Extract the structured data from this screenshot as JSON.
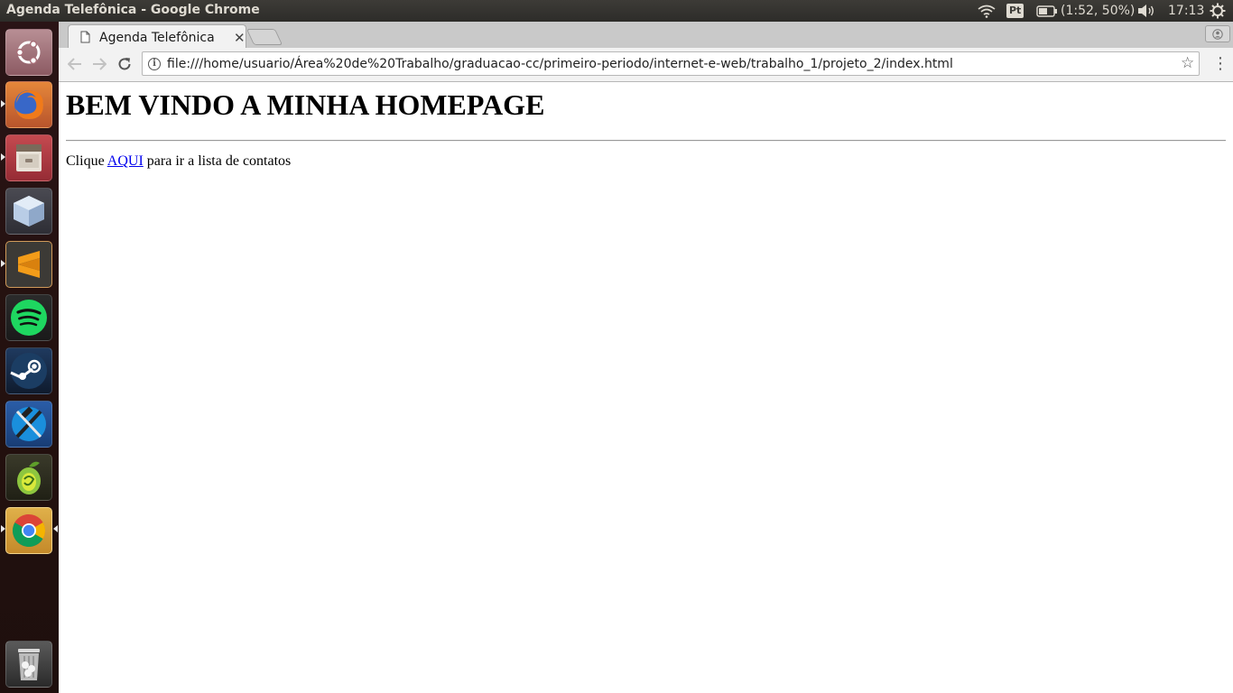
{
  "system_panel": {
    "window_title": "Agenda Telefônica - Google Chrome",
    "keyboard_layout": "Pt",
    "battery": "(1:52, 50%)",
    "clock": "17:13",
    "icons": [
      "wifi-icon",
      "battery-icon",
      "volume-icon",
      "power-gear-icon"
    ]
  },
  "launcher": {
    "items": [
      {
        "name": "ubuntu-dash",
        "icon": "ubuntu-logo-icon"
      },
      {
        "name": "firefox",
        "icon": "firefox-icon"
      },
      {
        "name": "files",
        "icon": "file-cabinet-icon"
      },
      {
        "name": "virtualbox",
        "icon": "cube-icon"
      },
      {
        "name": "sublime-text",
        "icon": "sublime-s-icon"
      },
      {
        "name": "spotify",
        "icon": "spotify-icon"
      },
      {
        "name": "steam",
        "icon": "steam-icon"
      },
      {
        "name": "xcode-like-tool",
        "icon": "hammer-icon"
      },
      {
        "name": "app-green",
        "icon": "green-fruit-icon"
      },
      {
        "name": "chrome",
        "icon": "chrome-icon"
      }
    ],
    "trash": {
      "icon": "trash-icon"
    }
  },
  "browser": {
    "tab_title": "Agenda Telefônica",
    "url": "file:///home/usuario/Área%20de%20Trabalho/graduacao-cc/primeiro-periodo/internet-e-web/trabalho_1/projeto_2/index.html"
  },
  "page": {
    "heading": "BEM VINDO A MINHA HOMEPAGE",
    "paragraph_prefix": "Clique ",
    "link_text": "AQUI",
    "paragraph_suffix": " para ir a lista de contatos"
  },
  "colors": {
    "panel_bg": "#3c3b37",
    "link": "#0000ee",
    "launcher_bg": "#24110f"
  }
}
